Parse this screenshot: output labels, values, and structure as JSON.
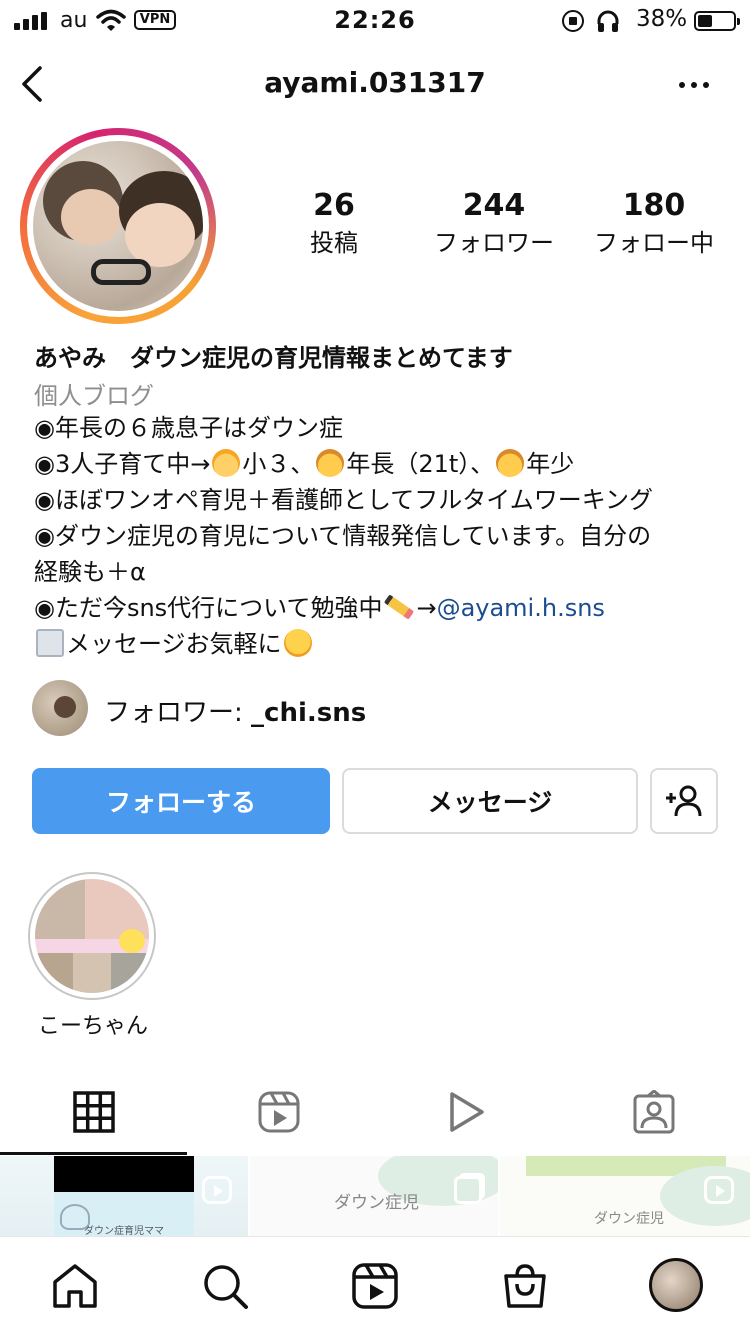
{
  "status_bar": {
    "carrier": "au",
    "vpn": "VPN",
    "time": "22:26",
    "battery": "38%"
  },
  "header": {
    "username": "ayami.031317"
  },
  "stats": {
    "posts": {
      "value": "26",
      "label": "投稿"
    },
    "followers": {
      "value": "244",
      "label": "フォロワー"
    },
    "following": {
      "value": "180",
      "label": "フォロー中"
    }
  },
  "bio": {
    "name": "あやみ　ダウン症児の育児情報まとめてます",
    "category": "個人ブログ",
    "line1": "◉年長の６歳息子はダウン症",
    "line2_a": "◉3人子育て中→",
    "line2_b": "小３、",
    "line2_c": "年長（21t）、",
    "line2_d": "年少",
    "line3": "◉ほぼワンオペ育児＋看護師としてフルタイムワーキング",
    "line4": "◉ダウン症児の育児について情報発信しています。自分の",
    "line5": "経験も＋α",
    "line6_a": "◉ただ今sns代行について勉強中",
    "line6_b": "→",
    "line6_link": "@ayami.h.sns",
    "line7": "メッセージお気軽に"
  },
  "followed_by": {
    "prefix": "フォロワー: ",
    "name": "_chi.sns"
  },
  "actions": {
    "follow": "フォローする",
    "message": "メッセージ"
  },
  "highlights": [
    {
      "label": "こーちゃん"
    }
  ],
  "thumbnails": {
    "t1_caption": "ダウン症育児ママ",
    "t2_caption": "ダウン症児",
    "t3_caption": "ダウン症児"
  },
  "colors": {
    "follow_button": "#4a9af0",
    "link": "#1d4c8f",
    "muted": "#8e8e8e"
  },
  "icons": {
    "tabs": [
      "grid-icon",
      "reels-icon",
      "video-icon",
      "tagged-icon"
    ],
    "nav": [
      "home-icon",
      "search-icon",
      "reels-icon",
      "shop-icon",
      "profile-avatar"
    ]
  }
}
